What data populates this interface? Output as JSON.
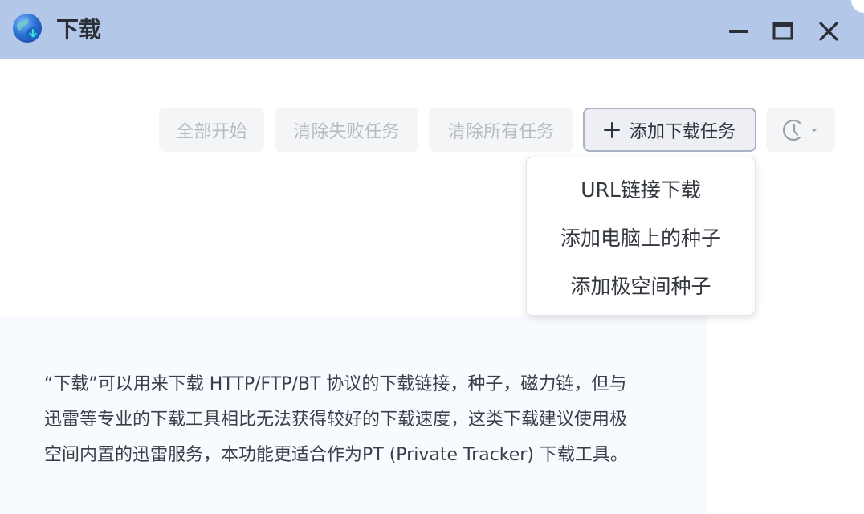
{
  "window": {
    "title": "下载",
    "icon": "globe-download-icon",
    "controls": [
      "minimize-icon",
      "maximize-icon",
      "close-icon"
    ],
    "accent": "#b3c7e8"
  },
  "toolbar": {
    "start_all": "全部开始",
    "clear_failed": "清除失败任务",
    "clear_all": "清除所有任务",
    "add_task": "添加下载任务",
    "add_task_icon": "plus-icon",
    "history_icon": "clock-icon"
  },
  "add_menu": {
    "items": [
      {
        "label": "URL链接下载"
      },
      {
        "label": "添加电脑上的种子"
      },
      {
        "label": "添加极空间种子"
      }
    ]
  },
  "info": {
    "text": "“下载”可以用来下载 HTTP/FTP/BT 协议的下载链接，种子，磁力链，但与迅雷等专业的下载工具相比无法获得较好的下载速度，这类下载建议使用极空间内置的迅雷服务，本功能更适合作为PT (Private Tracker) 下载工具。"
  }
}
